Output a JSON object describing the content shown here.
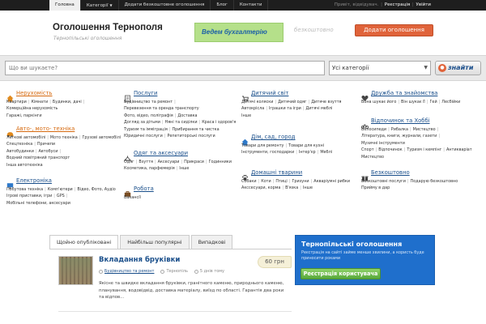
{
  "topnav": {
    "items": [
      "Головна",
      "Категорії",
      "Додати безкоштовне оголошення",
      "Блог",
      "Контакти"
    ],
    "greeting": "Привіт, відвідувач.",
    "register": "Реєстрація",
    "login": "Увійти"
  },
  "header": {
    "title": "Оголошення Тернополя",
    "subtitle": "Тернопільські оголошення",
    "banner_text": "Ведем бухгалтерію",
    "free_text": "безкоштовно",
    "add_button": "Додати оголошення"
  },
  "search": {
    "placeholder": "Що ви шукаєте?",
    "category_value": "Усі категорії",
    "button": "знайти"
  },
  "categories": {
    "c1": {
      "title": "Нерухомість",
      "subs": [
        "Квартири",
        "Кімнати",
        "Будинки, дачі",
        "Комерційна нерухомість",
        "Гаражі, паркінги"
      ]
    },
    "c2": {
      "title": "Авто-, мото- техніка",
      "subs": [
        "Легкові автомобілі",
        "Мото техніка",
        "Грузові автомобілі",
        "Спецтехніка",
        "Причепи",
        "Автобудинки",
        "Автобуси",
        "Водний повітряний транспорт",
        "Інша автотехніка"
      ]
    },
    "c3": {
      "title": "Електроніка",
      "subs": [
        "Побутова техніка",
        "Комп'ютери",
        "Відео, Фото, Аудіо",
        "Ігрові приставки, ігри",
        "GPS",
        "Мобільні телефони, аксесуари"
      ]
    },
    "c4": {
      "title": "Послуги",
      "subs": [
        "Будівництво та ремонт",
        "Перевезення та оренда транспорту",
        "Фото, відео, поліграфія",
        "Доставка",
        "Догляд за дітьми",
        "Няні та сиділки",
        "Краса і здоров'я",
        "Туризм та імміграція",
        "Прибирання та чистка",
        "Юридичні послуги",
        "Репетиторські послуги"
      ]
    },
    "c5": {
      "title": "Одяг та аксесуари",
      "subs": [
        "Одяг",
        "Взуття",
        "Аксесуари",
        "Прикраси",
        "Годинники",
        "Косметика, парфюмерія",
        "Інше"
      ]
    },
    "c6": {
      "title": "Робота",
      "subs": [
        "Вакансії"
      ]
    },
    "c7": {
      "title": "Дитячий світ",
      "subs": [
        "Дитячі коляски",
        "Дитячий одяг",
        "Дитяче взуття",
        "Автокрісла",
        "Іграшки та ігри",
        "Дитячі меблі",
        "Інше"
      ]
    },
    "c8": {
      "title": "Дім, сад, город",
      "subs": [
        "Товари для ремонту",
        "Товари для кухні",
        "Інструменти, господарки",
        "Інтер'єр",
        "Меблі"
      ]
    },
    "c9": {
      "title": "Домашні тварини",
      "subs": [
        "Собаки",
        "Коти",
        "Птиці",
        "Гризуни",
        "Акваріумні рибки",
        "Акссесуари, корма",
        "В'язка",
        "Інше"
      ]
    },
    "c10": {
      "title": "Дружба та знайомства",
      "subs": [
        "Вона шукає його",
        "Він шукає її",
        "Гей",
        "Лесбійки"
      ]
    },
    "c11": {
      "title": "Відпочинок та Хоббі",
      "subs": [
        "Велосипеди",
        "Рибалка",
        "Мистецтво",
        "Література, книги, журнали, газети",
        "Музичні інструменти",
        "Спорт",
        "Відпочинок",
        "Туризм і кемпінг",
        "Антикваріат",
        "Мистецтво"
      ]
    },
    "c12": {
      "title": "Безкоштовно",
      "subs": [
        "Безкоштовні послуги",
        "Подарую безкоштовно",
        "Прийму в дар"
      ]
    }
  },
  "tabs": [
    "Щойно опубліковані",
    "Найбільш популярні",
    "Випадкові"
  ],
  "listing": {
    "title": "Вкладання бруківки",
    "price": "60 грн",
    "category": "Будівництво та ремонт",
    "city": "Тернопіль",
    "time": "5 днів тому",
    "description": "Якісне та швидке вкладання бруківки, гранітного каменю, природнього каменю, планування, водовідвід, доставка матеріалу, виїзд по області. Гарантія два роки та відпов..."
  },
  "promo": {
    "title": "Тернопільські оголошення",
    "text": "Реєстрація на сайті займе менше хвилини, а користь буде приносити роками",
    "button": "Реєстрація користувача"
  },
  "colors": {
    "accent": "#e0633a",
    "link": "#1a4f8b",
    "promo": "#1f6fcc",
    "button_green": "#58a83a"
  }
}
